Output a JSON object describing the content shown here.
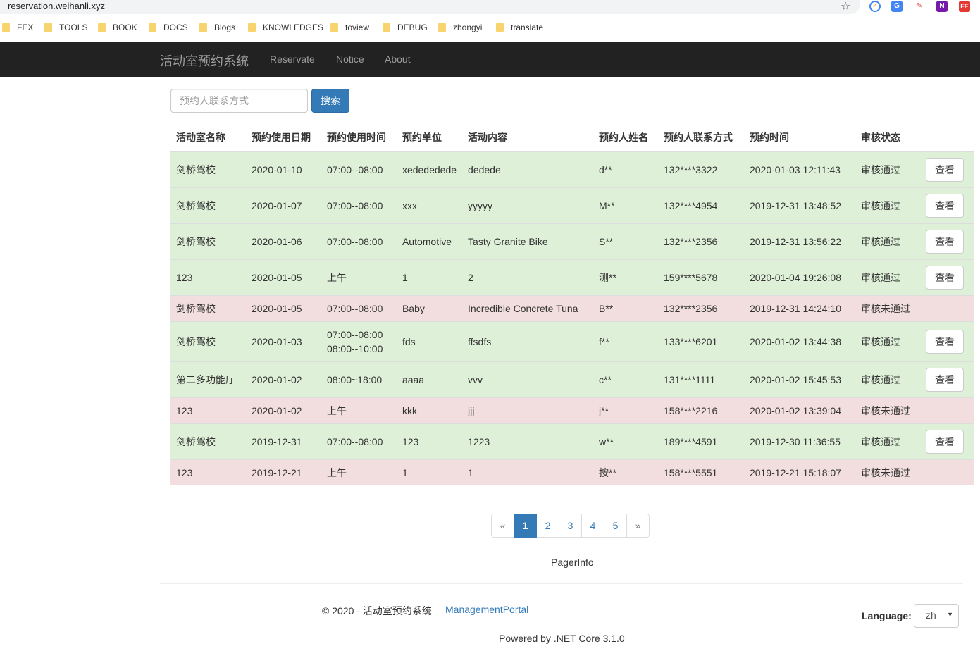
{
  "browser": {
    "url": "reservation.weihanli.xyz",
    "bookmarks": [
      "FEX",
      "TOOLS",
      "BOOK",
      "DOCS",
      "Blogs",
      "KNOWLEDGES",
      "toview",
      "DEBUG",
      "zhongyi",
      "translate"
    ],
    "ext_icons": [
      "todo-check-icon",
      "google-translate-icon",
      "pen-icon",
      "onenote-icon",
      "fe-icon"
    ],
    "ext_labels": {
      "onenote": "N",
      "fe": "FE"
    }
  },
  "navbar": {
    "brand": "活动室预约系统",
    "links": [
      "Reservate",
      "Notice",
      "About"
    ]
  },
  "search": {
    "placeholder": "预约人联系方式",
    "button": "搜索"
  },
  "table": {
    "headers": [
      "活动室名称",
      "预约使用日期",
      "预约使用时间",
      "预约单位",
      "活动内容",
      "预约人姓名",
      "预约人联系方式",
      "预约时间",
      "审核状态"
    ],
    "view_label": "查看",
    "rows": [
      {
        "room": "剑桥驾校",
        "date": "2020-01-10",
        "time": [
          "07:00--08:00"
        ],
        "unit": "xedededede",
        "content": "dedede",
        "name": "d**",
        "phone": "132****3322",
        "reserved_at": "2020-01-03 12:11:43",
        "status": "审核通过",
        "approved": true
      },
      {
        "room": "剑桥驾校",
        "date": "2020-01-07",
        "time": [
          "07:00--08:00"
        ],
        "unit": "xxx",
        "content": "yyyyy",
        "name": "M**",
        "phone": "132****4954",
        "reserved_at": "2019-12-31 13:48:52",
        "status": "审核通过",
        "approved": true
      },
      {
        "room": "剑桥驾校",
        "date": "2020-01-06",
        "time": [
          "07:00--08:00"
        ],
        "unit": "Automotive",
        "content": "Tasty Granite Bike",
        "name": "S**",
        "phone": "132****2356",
        "reserved_at": "2019-12-31 13:56:22",
        "status": "审核通过",
        "approved": true
      },
      {
        "room": "123",
        "date": "2020-01-05",
        "time": [
          "上午"
        ],
        "unit": "1",
        "content": "2",
        "name": "测**",
        "phone": "159****5678",
        "reserved_at": "2020-01-04 19:26:08",
        "status": "审核通过",
        "approved": true
      },
      {
        "room": "剑桥驾校",
        "date": "2020-01-05",
        "time": [
          "07:00--08:00"
        ],
        "unit": "Baby",
        "content": "Incredible Concrete Tuna",
        "name": "B**",
        "phone": "132****2356",
        "reserved_at": "2019-12-31 14:24:10",
        "status": "审核未通过",
        "approved": false
      },
      {
        "room": "剑桥驾校",
        "date": "2020-01-03",
        "time": [
          "07:00--08:00",
          "08:00--10:00"
        ],
        "unit": "fds",
        "content": "ffsdfs",
        "name": "f**",
        "phone": "133****6201",
        "reserved_at": "2020-01-02 13:44:38",
        "status": "审核通过",
        "approved": true
      },
      {
        "room": "第二多功能厅",
        "date": "2020-01-02",
        "time": [
          "08:00~18:00"
        ],
        "unit": "aaaa",
        "content": "vvv",
        "name": "c**",
        "phone": "131****1111",
        "reserved_at": "2020-01-02 15:45:53",
        "status": "审核通过",
        "approved": true
      },
      {
        "room": "123",
        "date": "2020-01-02",
        "time": [
          "上午"
        ],
        "unit": "kkk",
        "content": "jjj",
        "name": "j**",
        "phone": "158****2216",
        "reserved_at": "2020-01-02 13:39:04",
        "status": "审核未通过",
        "approved": false
      },
      {
        "room": "剑桥驾校",
        "date": "2019-12-31",
        "time": [
          "07:00--08:00"
        ],
        "unit": "123",
        "content": "1223",
        "name": "w**",
        "phone": "189****4591",
        "reserved_at": "2019-12-30 11:36:55",
        "status": "审核通过",
        "approved": true
      },
      {
        "room": "123",
        "date": "2019-12-21",
        "time": [
          "上午"
        ],
        "unit": "1",
        "content": "1",
        "name": "按**",
        "phone": "158****5551",
        "reserved_at": "2019-12-21 15:18:07",
        "status": "审核未通过",
        "approved": false
      }
    ]
  },
  "pagination": {
    "prev": "«",
    "pages": [
      "1",
      "2",
      "3",
      "4",
      "5"
    ],
    "next": "»",
    "current": "1",
    "info": "PagerInfo"
  },
  "footer": {
    "copyright": "© 2020 - 活动室预约系统",
    "portal_link": "ManagementPortal",
    "powered": "Powered by .NET Core 3.1.0",
    "language_label": "Language:",
    "language_value": "zh"
  },
  "colors": {
    "navbar_bg": "#222222",
    "primary": "#337ab7",
    "row_success": "#dff0d8",
    "row_danger": "#f2dede"
  }
}
